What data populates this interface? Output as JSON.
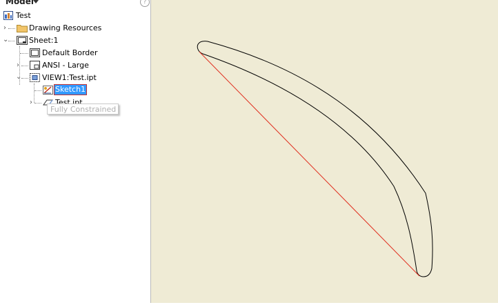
{
  "browser": {
    "title": "Model",
    "help_glyph": "?",
    "items": [
      {
        "label": "Test",
        "icon": "drawing-document-icon"
      },
      {
        "label": "Drawing Resources",
        "icon": "folder-icon"
      },
      {
        "label": "Sheet:1",
        "icon": "sheet-icon"
      },
      {
        "label": "Default Border",
        "icon": "border-icon"
      },
      {
        "label": "ANSI - Large",
        "icon": "title-block-icon"
      },
      {
        "label": "VIEW1:Test.ipt",
        "icon": "drawing-view-icon"
      },
      {
        "label": "Sketch1",
        "icon": "sketch-icon",
        "selected": true
      },
      {
        "label": "Test.ipt",
        "icon": "part-icon"
      }
    ],
    "tooltip": "Fully Constrained"
  },
  "canvas": {
    "background": "#efebd5",
    "sketch_line_color": "#e03020",
    "geometry_color": "#000000"
  }
}
